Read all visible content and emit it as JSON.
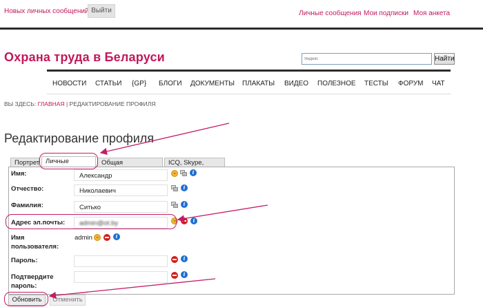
{
  "topbar": {
    "messages_text": "Новых личных сообщений нет",
    "logout_label": "Выйти",
    "links": [
      "Личные сообщения",
      "Мои подписки",
      "Моя анкета"
    ]
  },
  "header": {
    "site_title": "Охрана труда в Беларуси",
    "search_placeholder": "Яндекс",
    "search_button": "Найти"
  },
  "nav": {
    "items": [
      "НОВОСТИ",
      "СТАТЬИ",
      "{GP}",
      "БЛОГИ",
      "ДОКУМЕНТЫ",
      "ПЛАКАТЫ",
      "ВИДЕО",
      "ПОЛЕЗНОЕ",
      "ТЕСТЫ",
      "ФОРУМ",
      "ЧАТ"
    ]
  },
  "breadcrumb": {
    "prefix": "ВЫ ЗДЕСЬ:",
    "home": "ГЛАВНАЯ",
    "separator": "|",
    "current": "РЕДАКТИРОВАНИЕ ПРОФИЛЯ"
  },
  "page": {
    "title": "Редактирование профиля"
  },
  "tabs": [
    "Портрет",
    "Личные данные",
    "Общая информация",
    "ICQ, Skype, Yahoo"
  ],
  "active_tab": "Личные данные",
  "form": {
    "first_name_label": "Имя:",
    "first_name_value": "Александр",
    "patronymic_label": "Отчество:",
    "patronymic_value": "Николаевич",
    "last_name_label": "Фамилия:",
    "last_name_value": "Ситько",
    "email_label": "Адрес эл.почты:",
    "email_value": "admin@ot.by",
    "username_label_line1": "Имя",
    "username_label_line2": "пользователя:",
    "username_value": "admin",
    "password_label": "Пароль:",
    "password_confirm_label_line1": "Подтвердите",
    "password_confirm_label_line2": "пароль:"
  },
  "actions": {
    "update_label": "Обновить",
    "cancel_label": "Отменить"
  },
  "colors": {
    "accent": "#c2185b",
    "highlight": "#c41c66"
  }
}
